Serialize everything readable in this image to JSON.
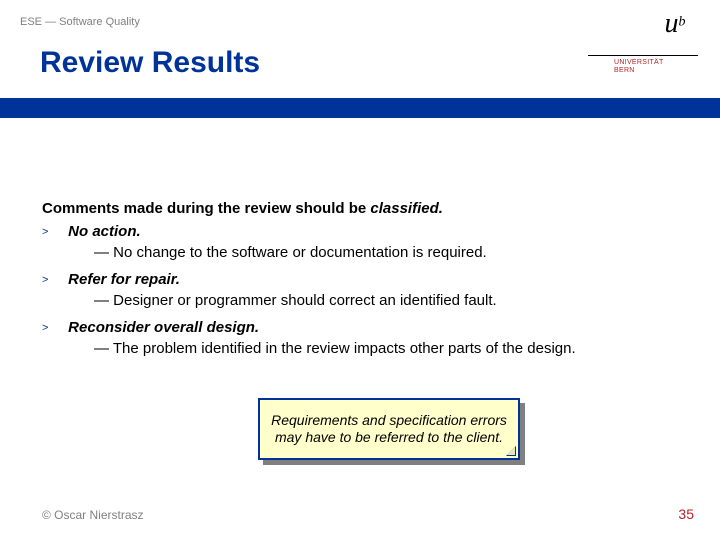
{
  "header": {
    "course": "ESE — Software Quality"
  },
  "logo": {
    "u": "u",
    "b": "b",
    "line1": "UNIVERSITÄT",
    "line2": "BERN"
  },
  "title": "Review Results",
  "content": {
    "lead_prefix": "Comments made during the review should be ",
    "lead_em": "classified.",
    "bullet_marker": ">",
    "items": [
      {
        "label": "No action.",
        "sub": "— No change to the software or documentation is required."
      },
      {
        "label": "Refer for repair.",
        "sub": "— Designer or programmer should correct an identified fault."
      },
      {
        "label": "Reconsider overall design.",
        "sub": "— The problem identified in the review impacts other parts of the design."
      }
    ]
  },
  "callout": {
    "text": "Requirements and specification errors may have to be referred to the client."
  },
  "footer": {
    "copyright": "© Oscar Nierstrasz",
    "page": "35"
  }
}
